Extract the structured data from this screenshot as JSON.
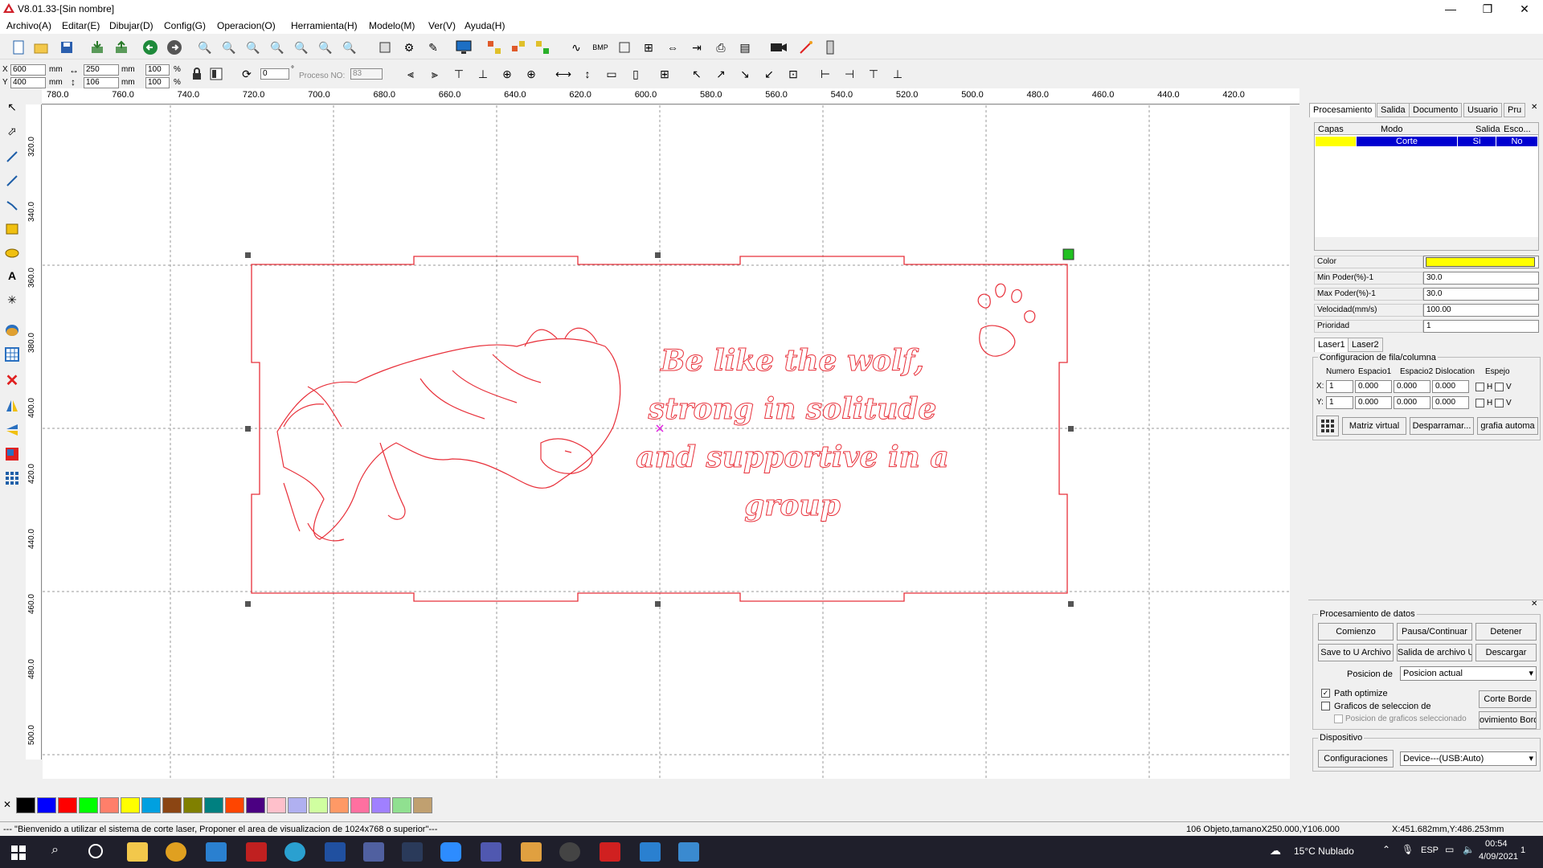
{
  "window": {
    "title": "V8.01.33-[Sin nombre]",
    "minimize": "—",
    "restore": "❐",
    "close": "✕"
  },
  "menu": [
    "Archivo(A)",
    "Editar(E)",
    "Dibujar(D)",
    "Config(G)",
    "Operacion(O)",
    "Herramienta(H)",
    "Modelo(M)",
    "Ver(V)",
    "Ayuda(H)"
  ],
  "toolbar2": {
    "x_label": "X",
    "y_label": "Y",
    "x_value": "600",
    "y_value": "400",
    "width_value": "250",
    "height_value": "106",
    "unit": "mm",
    "scale_w": "100",
    "scale_h": "100",
    "percent": "%",
    "rotate_value": "0",
    "degree": "°",
    "proceso_label": "Proceso NO:",
    "proceso_value": "83"
  },
  "ruler_top": [
    "780.0",
    "760.0",
    "740.0",
    "720.0",
    "700.0",
    "680.0",
    "660.0",
    "640.0",
    "620.0",
    "600.0",
    "580.0",
    "560.0",
    "540.0",
    "520.0",
    "500.0",
    "480.0",
    "460.0",
    "440.0",
    "420.0"
  ],
  "ruler_left": [
    "320.0",
    "340.0",
    "360.0",
    "380.0",
    "400.0",
    "420.0",
    "440.0",
    "460.0",
    "480.0",
    "500.0"
  ],
  "design": {
    "line1": "Be like the wolf,",
    "line2": "strong in solitude",
    "line3": "and supportive in a",
    "line4": "group",
    "stroke_color": "#e8303a"
  },
  "palette": [
    "#000000",
    "#0000ff",
    "#ff0000",
    "#00ff00",
    "#ff7f6a",
    "#ffff00",
    "#00a0e0",
    "#8b4513",
    "#808000",
    "#008080",
    "#ff4500",
    "#4b0082",
    "#ffc0cb",
    "#b0b0f0",
    "#d0ffa0",
    "#ff9966",
    "#ff70a0",
    "#a080ff",
    "#90e090",
    "#c0a070"
  ],
  "panel": {
    "tabs": [
      "Procesamiento",
      "Salida",
      "Documento",
      "Usuario",
      "Pru"
    ],
    "layers_headers": [
      "Capas",
      "Modo",
      "Salida",
      "Esco..."
    ],
    "layer_row": {
      "mode": "Corte",
      "output": "Si",
      "select": "No",
      "color": "#ffff00"
    },
    "props": [
      {
        "label": "Color",
        "value": ""
      },
      {
        "label": "Min Poder(%)-1",
        "value": "30.0"
      },
      {
        "label": "Max Poder(%)-1",
        "value": "30.0"
      },
      {
        "label": "Velocidad(mm/s)",
        "value": "100.00"
      },
      {
        "label": "Prioridad",
        "value": "1"
      }
    ],
    "laser_tabs": [
      "Laser1",
      "Laser2"
    ],
    "rowcol_title": "Configuracion de fila/columna",
    "rowcol_headers": [
      "Numero",
      "Espacio1",
      "Espacio2",
      "Dislocation",
      "Espejo"
    ],
    "x_row": [
      "1",
      "0.000",
      "0.000",
      "0.000"
    ],
    "y_row": [
      "1",
      "0.000",
      "0.000",
      "0.000"
    ],
    "h": "H",
    "v": "V",
    "btn_matriz": "Matriz virtual",
    "btn_desparramar": "Desparramar...",
    "btn_grafia": "grafia automa",
    "data_title": "Procesamiento de datos",
    "btn_comienzo": "Comienzo",
    "btn_pausa": "Pausa/Continuar",
    "btn_detener": "Detener",
    "btn_save_u": "Save to U Archivo",
    "btn_salida_u": "Salida de archivo U",
    "btn_descargar": "Descargar",
    "posicion_label": "Posicion de",
    "posicion_value": "Posicion actual",
    "path_optimize": "Path optimize",
    "graficos_sel": "Graficos de seleccion de",
    "posicion_graficos": "Posicion de graficos seleccionado",
    "btn_corte_borde": "Corte Borde",
    "btn_movimiento": "ovimiento Bord",
    "dispositivo_title": "Dispositivo",
    "btn_config": "Configuraciones",
    "device_value": "Device---(USB:Auto)"
  },
  "status": {
    "message": "--- \"Bienvenido a utilizar el sistema de corte laser, Proponer el area de visualizacion de 1024x768 o superior\"---",
    "object": "106 Objeto,tamanoX250.000,Y106.000",
    "coords": "X:451.682mm,Y:486.253mm"
  },
  "taskbar": {
    "weather": "15°C  Nublado",
    "lang": "ESP",
    "time": "00:54",
    "date": "4/09/2021",
    "notif": "1"
  }
}
